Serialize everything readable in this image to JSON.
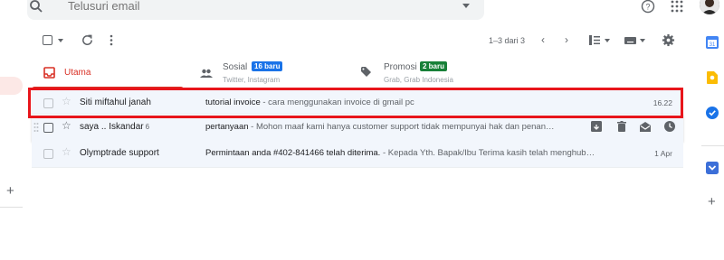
{
  "search": {
    "placeholder": "Telusuri email"
  },
  "toolbar": {
    "pager_text": "1–3 dari 3",
    "prev": "‹",
    "next": "›"
  },
  "tabs": [
    {
      "label": "Utama",
      "active": true,
      "icon": "inbox-icon"
    },
    {
      "label": "Sosial",
      "badge": "16 baru",
      "sub": "Twitter, Instagram",
      "icon": "people-icon"
    },
    {
      "label": "Promosi",
      "badge": "2 baru",
      "sub": "Grab, Grab Indonesia",
      "icon": "tag-icon"
    }
  ],
  "emails": [
    {
      "sender": "Siti miftahul janah",
      "count": "",
      "subject": "tutorial invoice",
      "preview": " - cara menggunakan invoice di gmail pc",
      "time": "16.22"
    },
    {
      "sender": "saya .. Iskandar",
      "count": "6",
      "subject": "pertanyaan",
      "preview": " - Mohon maaf kami hanya customer support tidak mempunyai hak dan penan…",
      "time": ""
    },
    {
      "sender": "Olymptrade support",
      "count": "",
      "subject": "Permintaan anda #402-841466 telah diterima.",
      "preview": " - Kepada Yth. Bapak/Ibu Terima kasih telah menghub…",
      "time": "1 Apr"
    }
  ],
  "rail": {
    "calendar_label": "31",
    "plus": "+"
  },
  "left": {
    "plus": "+"
  },
  "colors": {
    "accent_red": "#d93025",
    "highlight": "#e8151b",
    "social_badge": "#1a73e8",
    "promo_badge": "#188038"
  }
}
